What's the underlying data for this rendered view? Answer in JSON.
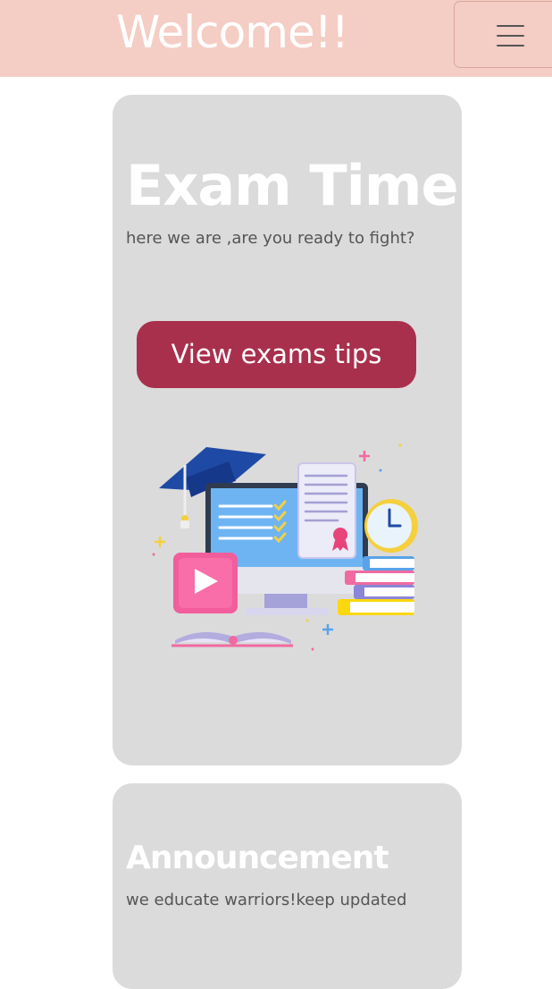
{
  "navbar": {
    "brand": "Welcome!!",
    "menu_icon": "hamburger-menu-icon"
  },
  "exam_card": {
    "title": "Exam Time",
    "text": "here we are ,are you ready to fight?",
    "button_label": "View exams tips",
    "illustration_icon": "online-exam-illustration",
    "button_color": "#a8304d"
  },
  "announcement_card": {
    "title": "Announcement",
    "text": "we educate warriors!keep updated"
  },
  "colors": {
    "navbar_bg": "#f4cdc4",
    "card_bg": "#dbdbdb"
  }
}
